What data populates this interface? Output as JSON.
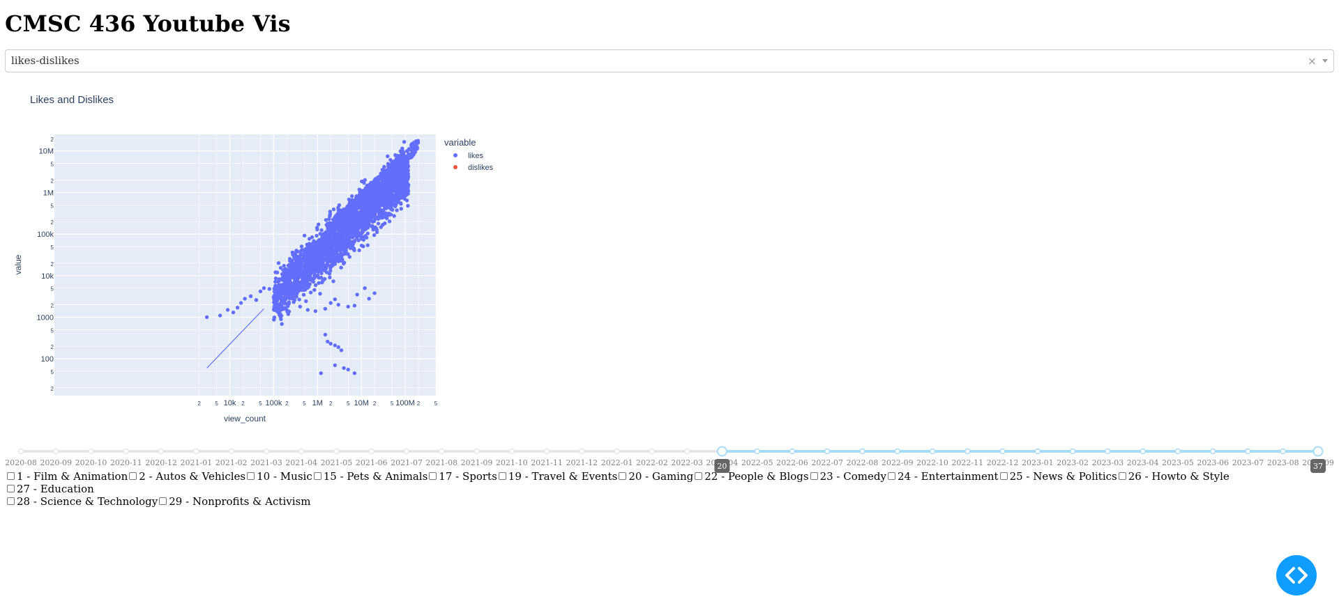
{
  "page": {
    "title": "CMSC 436 Youtube Vis"
  },
  "dropdown": {
    "value": "likes-dislikes",
    "clear_symbol": "×"
  },
  "chart_data": {
    "type": "scatter",
    "title": "Likes and Dislikes",
    "xlabel": "view_count",
    "ylabel": "value",
    "x_scale": "log",
    "y_scale": "log",
    "xlim": [
      1,
      500000000
    ],
    "ylim": [
      13,
      25000000
    ],
    "grid": true,
    "legend_title": "variable",
    "legend_position": "right",
    "x_tick_labels": [
      "2",
      "5",
      "10k",
      "2",
      "5",
      "100k",
      "2",
      "5",
      "1M",
      "2",
      "5",
      "10M",
      "2",
      "5",
      "100M",
      "2",
      "5"
    ],
    "y_tick_labels": [
      "2",
      "5",
      "100",
      "2",
      "5",
      "1000",
      "2",
      "5",
      "10k",
      "2",
      "5",
      "100k",
      "2",
      "5",
      "1M",
      "2",
      "5",
      "10M",
      "2"
    ],
    "series": [
      {
        "name": "likes",
        "color": "#636efa",
        "points": [
          [
            3000,
            1000
          ],
          [
            6000,
            1100
          ],
          [
            9000,
            1500
          ],
          [
            12000,
            1300
          ],
          [
            15000,
            1700
          ],
          [
            18000,
            2200
          ],
          [
            22000,
            2800
          ],
          [
            30000,
            3200
          ],
          [
            40000,
            2600
          ],
          [
            50000,
            4200
          ],
          [
            60000,
            5000
          ],
          [
            80000,
            4800
          ],
          [
            100000,
            3000
          ],
          [
            120000,
            2500
          ],
          [
            300000,
            2600
          ],
          [
            400000,
            1800
          ],
          [
            600000,
            1500
          ],
          [
            900000,
            1400
          ],
          [
            1500000,
            1600
          ],
          [
            2000000,
            2200
          ],
          [
            2500000,
            2700
          ],
          [
            3000000,
            2000
          ],
          [
            5000000,
            1800
          ],
          [
            7000000,
            1900
          ],
          [
            1500000,
            380
          ],
          [
            1700000,
            260
          ],
          [
            2000000,
            230
          ],
          [
            2500000,
            210
          ],
          [
            3000000,
            190
          ],
          [
            3500000,
            160
          ],
          [
            1200000,
            45
          ],
          [
            2500000,
            70
          ],
          [
            4000000,
            60
          ],
          [
            5000000,
            55
          ],
          [
            7000000,
            45
          ],
          [
            8000000,
            3500
          ],
          [
            12000000,
            5000
          ],
          [
            20000000,
            3800
          ],
          [
            15000000,
            2800
          ]
        ],
        "cloud": {
          "x_range": [
            100000,
            120000000
          ],
          "y_center_ratio": 0.03,
          "count": 2600
        }
      },
      {
        "name": "dislikes",
        "color": "#ef553b",
        "points": []
      }
    ]
  },
  "slider": {
    "ticks": [
      "2020-08",
      "2020-09",
      "2020-10",
      "2020-11",
      "2020-12",
      "2021-01",
      "2021-02",
      "2021-03",
      "2021-04",
      "2021-05",
      "2021-06",
      "2021-07",
      "2021-08",
      "2021-09",
      "2021-10",
      "2021-11",
      "2021-12",
      "2022-01",
      "2022-02",
      "2022-03",
      "2022-04",
      "2022-05",
      "2022-06",
      "2022-07",
      "2022-08",
      "2022-09",
      "2022-10",
      "2022-11",
      "2022-12",
      "2023-01",
      "2023-02",
      "2023-03",
      "2023-04",
      "2023-05",
      "2023-06",
      "2023-07",
      "2023-08",
      "2023-09"
    ],
    "start_index": 20,
    "end_index": 37,
    "start_label": "20",
    "end_label": "37",
    "track_color": "#e6e6e6",
    "active_color": "#a6dcf5"
  },
  "categories": [
    {
      "label": "1 - Film & Animation",
      "checked": false
    },
    {
      "label": "2 - Autos & Vehicles",
      "checked": false
    },
    {
      "label": "10 - Music",
      "checked": false
    },
    {
      "label": "15 - Pets & Animals",
      "checked": false
    },
    {
      "label": "17 - Sports",
      "checked": false
    },
    {
      "label": "19 - Travel & Events",
      "checked": false
    },
    {
      "label": "20 - Gaming",
      "checked": false
    },
    {
      "label": "22 - People & Blogs",
      "checked": false
    },
    {
      "label": "23 - Comedy",
      "checked": false
    },
    {
      "label": "24 - Entertainment",
      "checked": false
    },
    {
      "label": "25 - News & Politics",
      "checked": false
    },
    {
      "label": "26 - Howto & Style",
      "checked": false
    },
    {
      "label": "27 - Education",
      "checked": false
    },
    {
      "label": "28 - Science & Technology",
      "checked": false
    },
    {
      "label": "29 - Nonprofits & Activism",
      "checked": false
    }
  ],
  "fab": {
    "icon": "code-icon",
    "color": "#119dff"
  }
}
